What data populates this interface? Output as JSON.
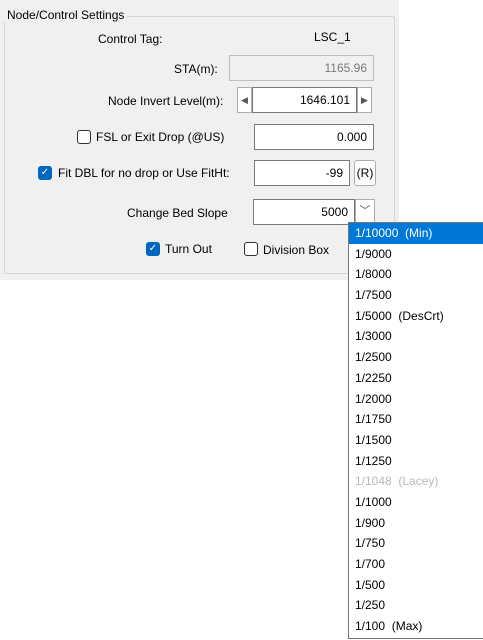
{
  "group": {
    "title": "Node/Control Settings"
  },
  "control_tag": {
    "label": "Control Tag:",
    "value": "LSC_1"
  },
  "sta": {
    "label": "STA(m):",
    "value": "1165.96"
  },
  "node_invert": {
    "label": "Node Invert Level(m):",
    "value": "1646.101",
    "left_icon": "left-arrow-icon",
    "right_icon": "right-arrow-icon"
  },
  "fsl": {
    "label": "FSL or Exit Drop (@US)",
    "checked": false,
    "value": "0.000"
  },
  "fit_dbl": {
    "label": "Fit DBL for no drop or Use FitHt:",
    "checked": true,
    "value": "-99",
    "r_button": "(R)"
  },
  "bed_slope": {
    "label": "Change Bed Slope",
    "value": "5000",
    "dropdown_icon": "chevron-down-icon"
  },
  "turn_out": {
    "label": "Turn Out",
    "checked": true
  },
  "division_box": {
    "label": "Division Box",
    "checked": false
  },
  "dropdown": {
    "selected_index": 0,
    "highlighted_index": 13,
    "items": [
      "1/10000  (Min)",
      "1/9000",
      "1/8000",
      "1/7500",
      "1/5000  (DesCrt)",
      "1/3000",
      "1/2500",
      "1/2250",
      "1/2000",
      "1/1750",
      "1/1500",
      "1/1250",
      "1/1048  (Lacey)",
      "1/1000",
      "1/900",
      "1/750",
      "1/700",
      "1/500",
      "1/250",
      "1/100  (Max)"
    ]
  },
  "colors": {
    "selection": "#0078d7",
    "checkbox_checked": "#0067c0",
    "highlight": "#ffff66",
    "panel": "#f0f0f0"
  }
}
